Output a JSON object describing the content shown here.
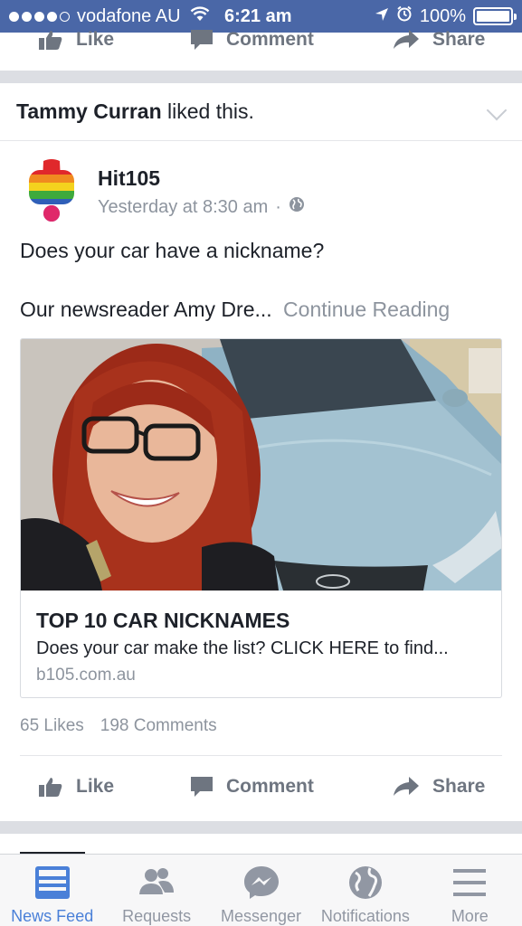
{
  "status_bar": {
    "carrier": "vodafone AU",
    "time": "6:21 am",
    "battery": "100%"
  },
  "top_actions": {
    "like": "Like",
    "comment": "Comment",
    "share": "Share"
  },
  "story": {
    "liker": "Tammy Curran",
    "liked_text": " liked this."
  },
  "post": {
    "page_name": "Hit105",
    "timestamp": "Yesterday at 8:30 am",
    "separator": "·",
    "text_line1": "Does your car have a nickname?",
    "text_line2": "Our newsreader Amy Dre...",
    "continue_reading": "Continue Reading",
    "link": {
      "title": "TOP 10 CAR NICKNAMES",
      "description": "Does your car make the list? CLICK HERE to find...",
      "domain": "b105.com.au"
    },
    "likes": "65 Likes",
    "comments": "198 Comments",
    "actions": {
      "like": "Like",
      "comment": "Comment",
      "share": "Share"
    }
  },
  "tab_bar": {
    "items": [
      {
        "label": "News Feed",
        "icon": "news-feed-icon",
        "active": true
      },
      {
        "label": "Requests",
        "icon": "friend-requests-icon",
        "active": false
      },
      {
        "label": "Messenger",
        "icon": "messenger-icon",
        "active": false
      },
      {
        "label": "Notifications",
        "icon": "globe-icon",
        "active": false
      },
      {
        "label": "More",
        "icon": "menu-icon",
        "active": false
      }
    ]
  },
  "colors": {
    "status_bar": "#4a67a7",
    "accent": "#4a80d8",
    "muted": "#8d949e"
  }
}
